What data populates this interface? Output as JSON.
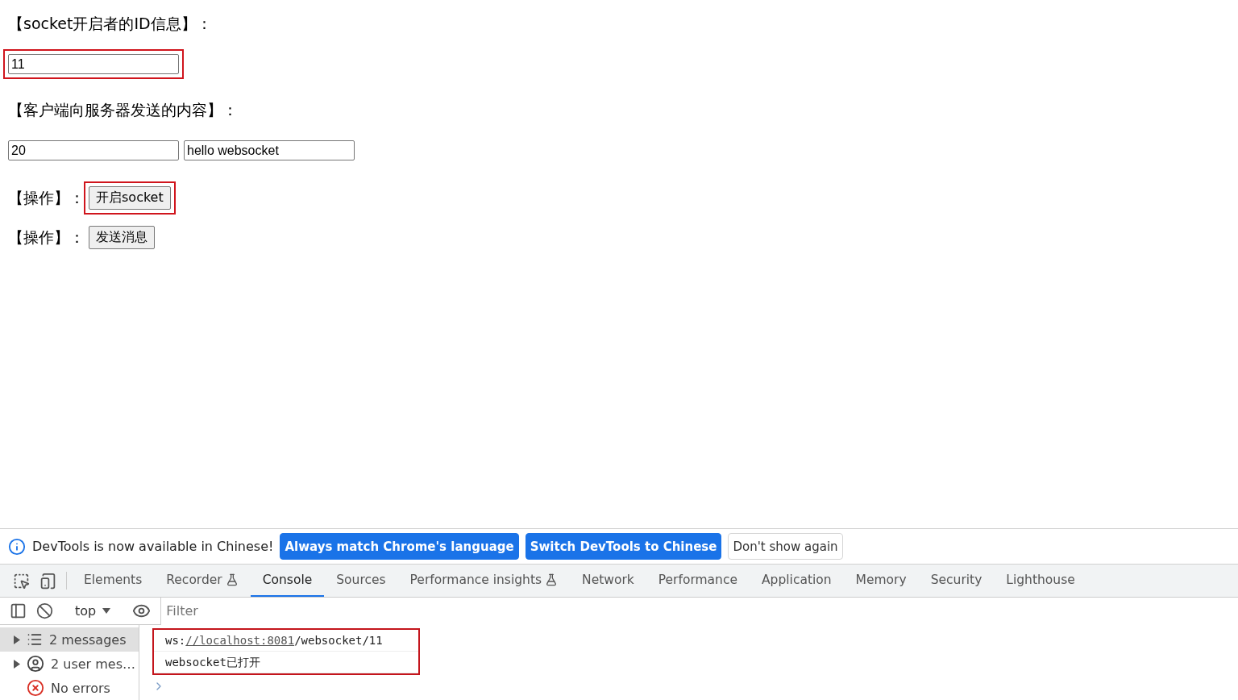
{
  "page": {
    "id_label": "【socket开启者的ID信息】：",
    "id_field": {
      "value": "11",
      "highlighted": true
    },
    "content_label": "【客户端向服务器发送的内容】：",
    "content_fields": [
      {
        "value": "20"
      },
      {
        "value": "hello websocket"
      }
    ],
    "actions": [
      {
        "label": "【操作】：",
        "button": "开启socket",
        "highlighted": true
      },
      {
        "label": "【操作】：",
        "button": "发送消息",
        "highlighted": false
      }
    ]
  },
  "devtools": {
    "banner": {
      "message": "DevTools is now available in Chinese!",
      "buttons": [
        {
          "label": "Always match Chrome's language",
          "kind": "primary"
        },
        {
          "label": "Switch DevTools to Chinese",
          "kind": "primary"
        },
        {
          "label": "Don't show again",
          "kind": "secondary"
        }
      ]
    },
    "tabs": [
      {
        "label": "Elements",
        "selected": false,
        "experimental": false
      },
      {
        "label": "Recorder",
        "selected": false,
        "experimental": true
      },
      {
        "label": "Console",
        "selected": true,
        "experimental": false
      },
      {
        "label": "Sources",
        "selected": false,
        "experimental": false
      },
      {
        "label": "Performance insights",
        "selected": false,
        "experimental": true
      },
      {
        "label": "Network",
        "selected": false,
        "experimental": false
      },
      {
        "label": "Performance",
        "selected": false,
        "experimental": false
      },
      {
        "label": "Application",
        "selected": false,
        "experimental": false
      },
      {
        "label": "Memory",
        "selected": false,
        "experimental": false
      },
      {
        "label": "Security",
        "selected": false,
        "experimental": false
      },
      {
        "label": "Lighthouse",
        "selected": false,
        "experimental": false
      }
    ],
    "toolbar": {
      "context": "top",
      "filter_placeholder": "Filter"
    },
    "sidebar": [
      {
        "kind": "messages",
        "label": "2 messages",
        "selected": true,
        "expandable": true
      },
      {
        "kind": "user",
        "label": "2 user mes…",
        "selected": false,
        "expandable": true
      },
      {
        "kind": "errors",
        "label": "No errors",
        "selected": false,
        "expandable": false
      }
    ],
    "log_highlighted": true,
    "log": [
      {
        "kind": "url",
        "before": "ws:",
        "link": "//localhost:8081",
        "after": "/websocket/11"
      },
      {
        "kind": "text",
        "text": "websocket已打开"
      }
    ]
  }
}
